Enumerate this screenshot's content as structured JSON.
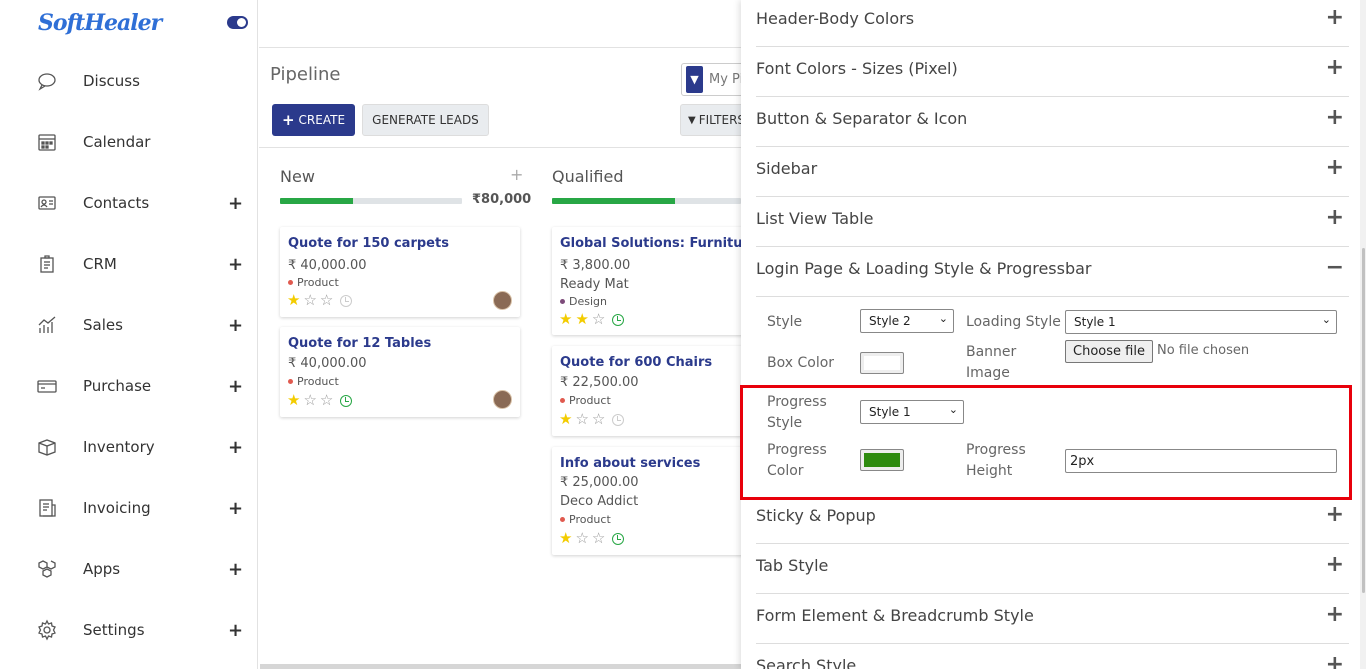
{
  "brand": {
    "logo_text": "SoftHealer"
  },
  "sidebar": {
    "items": [
      {
        "label": "Discuss",
        "icon": "chat-icon",
        "expandable": false
      },
      {
        "label": "Calendar",
        "icon": "calendar-icon",
        "expandable": false
      },
      {
        "label": "Contacts",
        "icon": "contact-card-icon",
        "expandable": true
      },
      {
        "label": "CRM",
        "icon": "crm-icon",
        "expandable": true
      },
      {
        "label": "Sales",
        "icon": "sales-chart-icon",
        "expandable": true
      },
      {
        "label": "Purchase",
        "icon": "credit-card-icon",
        "expandable": true
      },
      {
        "label": "Inventory",
        "icon": "box-icon",
        "expandable": true
      },
      {
        "label": "Invoicing",
        "icon": "invoice-icon",
        "expandable": true
      },
      {
        "label": "Apps",
        "icon": "apps-cubes-icon",
        "expandable": true
      },
      {
        "label": "Settings",
        "icon": "gear-icon",
        "expandable": true
      }
    ],
    "plus_symbol": "+"
  },
  "main": {
    "title": "Pipeline",
    "create_label": "CREATE",
    "generate_leads_label": "GENERATE LEADS",
    "search_facet_text": "My Pi",
    "filters_label": "FILTERS"
  },
  "columns": [
    {
      "title": "New",
      "total": "₹80,000",
      "progress": 0.4,
      "cards": [
        {
          "title": "Quote for 150 carpets",
          "amount": "₹ 40,000.00",
          "company": "",
          "tag": "Product",
          "tag_color": "#e05a4f",
          "stars": 1,
          "activity": "grey",
          "avatar": true
        },
        {
          "title": "Quote for 12 Tables",
          "amount": "₹ 40,000.00",
          "company": "",
          "tag": "Product",
          "tag_color": "#e05a4f",
          "stars": 1,
          "activity": "green",
          "avatar": true
        }
      ]
    },
    {
      "title": "Qualified",
      "total": "",
      "progress": 0.65,
      "cards": [
        {
          "title": "Global Solutions: Furnitures",
          "amount": "₹ 3,800.00",
          "company": "Ready Mat",
          "tag": "Design",
          "tag_color": "#7d4b7a",
          "stars": 2,
          "activity": "green",
          "avatar": false
        },
        {
          "title": "Quote for 600 Chairs",
          "amount": "₹ 22,500.00",
          "company": "",
          "tag": "Product",
          "tag_color": "#e05a4f",
          "stars": 1,
          "activity": "grey",
          "avatar": false
        },
        {
          "title": "Info about services",
          "amount": "₹ 25,000.00",
          "company": "Deco Addict",
          "tag": "Product",
          "tag_color": "#e05a4f",
          "stars": 1,
          "activity": "green",
          "avatar": false
        }
      ]
    }
  ],
  "panel": {
    "sections_top": [
      {
        "title": "Header-Body Colors",
        "state": "+"
      },
      {
        "title": "Font Colors - Sizes (Pixel)",
        "state": "+"
      },
      {
        "title": "Button & Separator & Icon",
        "state": "+"
      },
      {
        "title": "Sidebar",
        "state": "+"
      },
      {
        "title": "List View Table",
        "state": "+"
      }
    ],
    "open_section": {
      "title": "Login Page & Loading Style & Progressbar",
      "state": "−"
    },
    "form": {
      "style_label": "Style",
      "style_value": "Style 2",
      "loading_style_label": "Loading Style",
      "loading_style_value": "Style 1",
      "box_color_label": "Box Color",
      "box_color": "#ffffff",
      "banner_image_label": "Banner Image",
      "choose_file_label": "Choose file",
      "no_file_text": "No file chosen",
      "progress_style_label": "Progress Style",
      "progress_style_value": "Style 1",
      "progress_color_label": "Progress Color",
      "progress_color": "#2e8b0f",
      "progress_height_label": "Progress Height",
      "progress_height_value": "2px"
    },
    "sections_bottom": [
      {
        "title": "Sticky & Popup",
        "state": "+"
      },
      {
        "title": "Tab Style",
        "state": "+"
      },
      {
        "title": "Form Element & Breadcrumb Style",
        "state": "+"
      },
      {
        "title": "Search Style",
        "state": "+"
      }
    ]
  },
  "colors": {
    "accent": "#2b3a8c",
    "progress_green": "#28a745",
    "highlight": "#e8000b"
  }
}
